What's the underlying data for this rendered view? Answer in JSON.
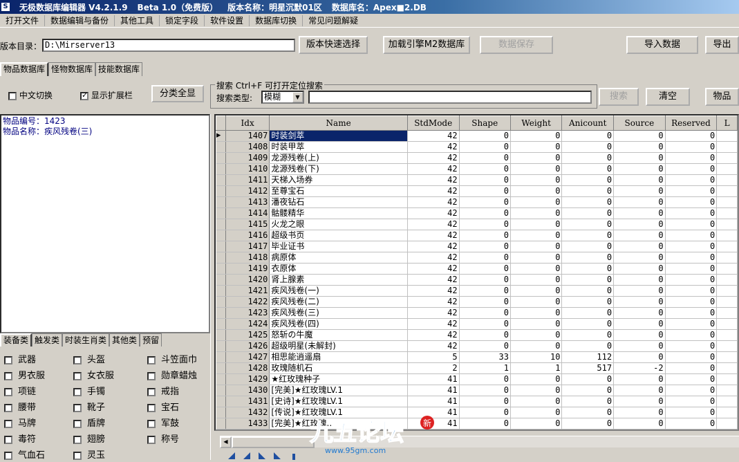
{
  "titlebar": {
    "app_title": "无极数据库编辑器 V4.2.1.9",
    "beta": "Beta 1.0（免费版）",
    "version_name": "版本名称：明星沉默01区",
    "db_name": "数据库名：Apex■2.DB"
  },
  "menu": [
    "打开文件",
    "数据编辑与备份",
    "其他工具",
    "锁定字段",
    "软件设置",
    "数据库切换",
    "常见问题解疑"
  ],
  "dir": {
    "label": "版本目录：",
    "value": "D:\\Mirserver13"
  },
  "buttons": {
    "quick_select": "版本快速选择",
    "load_m2": "加载引擎M2数据库",
    "save": "数据保存",
    "import": "导入数据",
    "export": "导出"
  },
  "db_tabs": [
    "物品数据库",
    "怪物数据库",
    "技能数据库"
  ],
  "options": {
    "chinese_switch": "中文切换",
    "show_ext": "显示扩展栏",
    "show_all": "分类全显"
  },
  "search": {
    "legend": "搜索  Ctrl+F 可打开定位搜索",
    "type_label": "搜索类型:",
    "type_value": "模糊",
    "search_btn": "搜索",
    "clear_btn": "清空",
    "item_btn": "物品"
  },
  "info": {
    "line1": "物品编号：1423",
    "line2": "物品名称：疾风残卷(三)"
  },
  "category_tabs": [
    "装备类",
    "触发类",
    "时装生肖类",
    "其他类",
    "预留"
  ],
  "categories": [
    "武器",
    "头盔",
    "斗笠面巾",
    "男衣服",
    "女衣服",
    "勋章蜡烛",
    "项链",
    "手镯",
    "戒指",
    "腰带",
    "靴子",
    "宝石",
    "马牌",
    "盾牌",
    "军鼓",
    "毒符",
    "翅膀",
    "称号",
    "气血石",
    "灵玉"
  ],
  "columns": [
    "Idx",
    "Name",
    "StdMode",
    "Shape",
    "Weight",
    "Anicount",
    "Source",
    "Reserved",
    "L"
  ],
  "rows": [
    [
      "1407",
      "时装剑萃",
      "42",
      "0",
      "0",
      "0",
      "0",
      "0"
    ],
    [
      "1408",
      "时装甲萃",
      "42",
      "0",
      "0",
      "0",
      "0",
      "0"
    ],
    [
      "1409",
      "龙源残卷(上)",
      "42",
      "0",
      "0",
      "0",
      "0",
      "0"
    ],
    [
      "1410",
      "龙源残卷(下)",
      "42",
      "0",
      "0",
      "0",
      "0",
      "0"
    ],
    [
      "1411",
      "天梯入场券",
      "42",
      "0",
      "0",
      "0",
      "0",
      "0"
    ],
    [
      "1412",
      "至尊宝石",
      "42",
      "0",
      "0",
      "0",
      "0",
      "0"
    ],
    [
      "1413",
      "潘夜钻石",
      "42",
      "0",
      "0",
      "0",
      "0",
      "0"
    ],
    [
      "1414",
      "骷髅精华",
      "42",
      "0",
      "0",
      "0",
      "0",
      "0"
    ],
    [
      "1415",
      "火龙之眼",
      "42",
      "0",
      "0",
      "0",
      "0",
      "0"
    ],
    [
      "1416",
      "超级书页",
      "42",
      "0",
      "0",
      "0",
      "0",
      "0"
    ],
    [
      "1417",
      "毕业证书",
      "42",
      "0",
      "0",
      "0",
      "0",
      "0"
    ],
    [
      "1418",
      "病原体",
      "42",
      "0",
      "0",
      "0",
      "0",
      "0"
    ],
    [
      "1419",
      "衣原体",
      "42",
      "0",
      "0",
      "0",
      "0",
      "0"
    ],
    [
      "1420",
      "肾上腺素",
      "42",
      "0",
      "0",
      "0",
      "0",
      "0"
    ],
    [
      "1421",
      "疾风残卷(一)",
      "42",
      "0",
      "0",
      "0",
      "0",
      "0"
    ],
    [
      "1422",
      "疾风残卷(二)",
      "42",
      "0",
      "0",
      "0",
      "0",
      "0"
    ],
    [
      "1423",
      "疾风残卷(三)",
      "42",
      "0",
      "0",
      "0",
      "0",
      "0"
    ],
    [
      "1424",
      "疾风残卷(四)",
      "42",
      "0",
      "0",
      "0",
      "0",
      "0"
    ],
    [
      "1425",
      "怒斩の牛魔",
      "42",
      "0",
      "0",
      "0",
      "0",
      "0"
    ],
    [
      "1426",
      "超级明星(未解封)",
      "42",
      "0",
      "0",
      "0",
      "0",
      "0"
    ],
    [
      "1427",
      "相思能逍遥扇",
      "5",
      "33",
      "10",
      "112",
      "0",
      "0"
    ],
    [
      "1428",
      "玫瑰随机石",
      "2",
      "1",
      "1",
      "517",
      "-2",
      "0"
    ],
    [
      "1429",
      "★红玫瑰种子",
      "41",
      "0",
      "0",
      "0",
      "0",
      "0"
    ],
    [
      "1430",
      "[完美]★红玫瑰LV.1",
      "41",
      "0",
      "0",
      "0",
      "0",
      "0"
    ],
    [
      "1431",
      "[史诗]★红玫瑰LV.1",
      "41",
      "0",
      "0",
      "0",
      "0",
      "0"
    ],
    [
      "1432",
      "[传说]★红玫瑰LV.1",
      "41",
      "0",
      "0",
      "0",
      "0",
      "0"
    ],
    [
      "1433",
      "[完美]★红玫瑰..",
      "41",
      "0",
      "0",
      "0",
      "0",
      "0"
    ]
  ],
  "watermark": {
    "logo_text": "九五论坛",
    "url": "www.95gm.com",
    "badge": "新"
  }
}
